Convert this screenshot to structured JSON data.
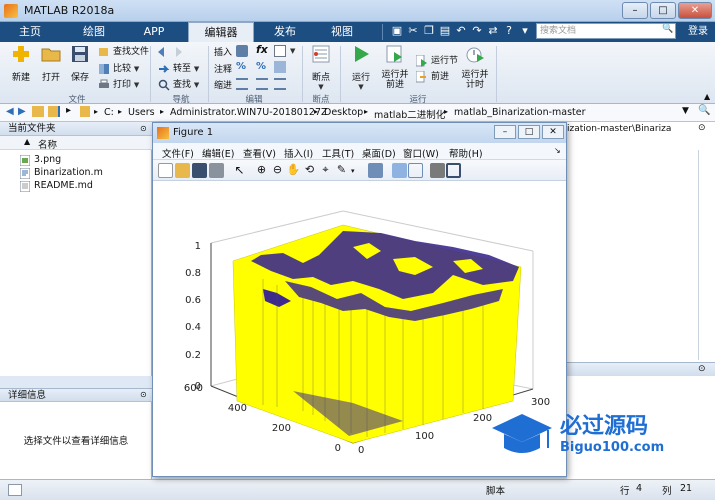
{
  "window": {
    "title": "MATLAB R2018a",
    "min": "–",
    "max": "□",
    "close": "✕"
  },
  "tabs": [
    {
      "label": "主页"
    },
    {
      "label": "绘图"
    },
    {
      "label": "APP"
    },
    {
      "label": "编辑器"
    },
    {
      "label": "发布"
    },
    {
      "label": "视图"
    }
  ],
  "search": {
    "placeholder": "搜索文档"
  },
  "login_label": "登录",
  "ribbon": {
    "file": {
      "group_label": "文件",
      "new": "新建",
      "open": "打开",
      "save": "保存",
      "find_files": "查找文件",
      "compare": "比较",
      "print": "打印"
    },
    "nav": {
      "group_label": "导航",
      "goto": "转至",
      "find": "查找"
    },
    "edit": {
      "group_label": "编辑",
      "insert": "插入",
      "comment": "注释",
      "indent": "缩进",
      "fx": "fx",
      "comment_icons": "%"
    },
    "breakpoints": {
      "group_label": "断点",
      "breakpoint": "断点"
    },
    "run": {
      "group_label": "运行",
      "run": "运行",
      "run_advance": "运行并\n前进",
      "run_section": "运行节",
      "advance": "前进",
      "run_time": "运行并\n计时"
    }
  },
  "address": {
    "crumbs": [
      "C:",
      "Users",
      "Administrator.WIN7U-20180127Z",
      "Desktop",
      "matlab二进制化",
      "matlab_Binarization-master"
    ]
  },
  "current_folder": {
    "title": "当前文件夹",
    "column": "名称",
    "files": [
      {
        "name": "3.png",
        "type": "image"
      },
      {
        "name": "Binarization.m",
        "type": "script"
      },
      {
        "name": "README.md",
        "type": "text"
      }
    ]
  },
  "details": {
    "title": "详细信息",
    "empty_text": "选择文件以查看详细信息"
  },
  "right_path": "ization-master\\Binariza",
  "status": {
    "encoding_label": "脚本",
    "row_label": "行",
    "row": "4",
    "col_label": "列",
    "col": "21"
  },
  "figure": {
    "title": "Figure 1",
    "menu": [
      "文件(F)",
      "编辑(E)",
      "查看(V)",
      "插入(I)",
      "工具(T)",
      "桌面(D)",
      "窗口(W)",
      "帮助(H)"
    ]
  },
  "chart_data": {
    "type": "surface",
    "surface_colors": [
      "#ffff00",
      "#3d2a8c"
    ],
    "z_ticks": [
      "0",
      "0.2",
      "0.4",
      "0.6",
      "0.8",
      "1"
    ],
    "y_ticks": [
      "0",
      "200",
      "400",
      "600"
    ],
    "x_ticks": [
      "0",
      "100",
      "200",
      "300"
    ],
    "zlim": [
      0,
      1
    ],
    "ylim": [
      0,
      600
    ],
    "xlim": [
      0,
      300
    ],
    "grid": true
  },
  "watermark": {
    "brand": "必过源码",
    "url": "Biguo100.com"
  }
}
